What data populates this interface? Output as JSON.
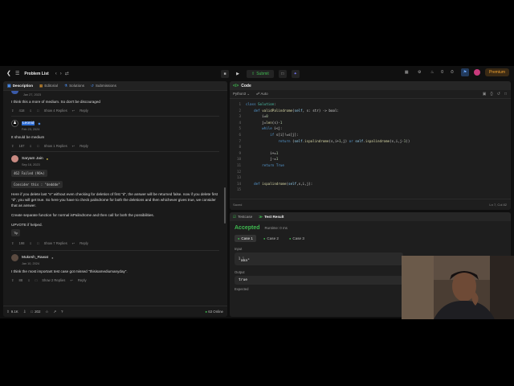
{
  "topbar": {
    "problem_list_label": "Problem List",
    "submit_label": "Submit",
    "streak_count": "0",
    "premium_label": "Premium",
    "avatar_letter": "N"
  },
  "left_tabs": [
    {
      "label": "Description",
      "icon": "description-icon"
    },
    {
      "label": "Editorial",
      "icon": "editorial-icon"
    },
    {
      "label": "Solutions",
      "icon": "solutions-icon"
    },
    {
      "label": "Submissions",
      "icon": "submissions-icon"
    }
  ],
  "comments": [
    {
      "name": "",
      "date": "Jan 27, 2023",
      "text": [
        "I think this a more of medium. So don't be discouraged"
      ],
      "votes": "418",
      "replies": "Show 4 Replies",
      "reply": "Reply"
    },
    {
      "name": "Leonid",
      "date": "Feb 23, 2024",
      "text": [
        "It should be medium"
      ],
      "votes": "187",
      "replies": "Show 1 Replies",
      "reply": "Reply"
    },
    {
      "name": "Saryam Jain",
      "date": "Sep 16, 2023",
      "code": "462 Failed (96%)",
      "consider": "Consider this : \"deddde\"",
      "text": [
        "Here if you delete last \"e\" without even checking for deletion of first \"d\", the answer will be returned false. now if you delete first \"d\", you will get true. So here you have to check palindrome for both the deletions and then whichever gives true, we consider that as answer.",
        "Create separate function for normal isPalindrome and then call for both the possibilities.",
        "UPVOTE if helped."
      ],
      "tip": "Tip",
      "votes": "198",
      "replies": "Show 7 Replies",
      "reply": "Reply"
    },
    {
      "name": "Mukesh_Rawat",
      "date": "Jan 10, 2024",
      "text": [
        "I think the most important test case got missed \"thisisamediumanyday\"."
      ],
      "votes": "88",
      "replies": "Show 2 Replies",
      "reply": "Reply"
    }
  ],
  "bottom_bar": {
    "likes": "9.1K",
    "comments": "202",
    "online": "63 Online"
  },
  "code": {
    "title": "Code",
    "language": "Python3",
    "mode": "Auto",
    "saved": "Saved",
    "cursor": "Ln 7, Col 82",
    "lines": [
      {
        "n": "1",
        "t": "class Solution:"
      },
      {
        "n": "2",
        "t": "    def validPalindrome(self, s: str) -> bool:"
      },
      {
        "n": "3",
        "t": "        i=0"
      },
      {
        "n": "4",
        "t": "        j=len(s)-1"
      },
      {
        "n": "5",
        "t": "        while i<j:"
      },
      {
        "n": "6",
        "t": "            if s[i]!=s[j]:"
      },
      {
        "n": "7",
        "t": "                return (self.ispalindrome(s,i+1,j) or self.ispalindrome(s,i,j-1))"
      },
      {
        "n": "8",
        "t": ""
      },
      {
        "n": "9",
        "t": "            i+=1"
      },
      {
        "n": "10",
        "t": "            j-=1"
      },
      {
        "n": "11",
        "t": "        return True"
      },
      {
        "n": "12",
        "t": ""
      },
      {
        "n": "13",
        "t": ""
      },
      {
        "n": "14",
        "t": "    def ispalindrome(self,s,i,j):"
      },
      {
        "n": "15",
        "t": ""
      }
    ]
  },
  "result": {
    "tabs": [
      {
        "label": "Testcase",
        "icon": "testcase-icon"
      },
      {
        "label": "Test Result",
        "icon": "test-result-icon"
      }
    ],
    "status": "Accepted",
    "runtime": "Runtime: 0 ms",
    "cases": [
      "Case 1",
      "Case 2",
      "Case 3"
    ],
    "input_label": "Input",
    "input_var": "s =",
    "input_value": "\"aba\"",
    "output_label": "Output",
    "output_value": "true",
    "expected_label": "Expected"
  },
  "colors": {
    "accent_green": "#3fb950",
    "accent_blue": "#4a8ef0",
    "premium": "#f0a230"
  }
}
